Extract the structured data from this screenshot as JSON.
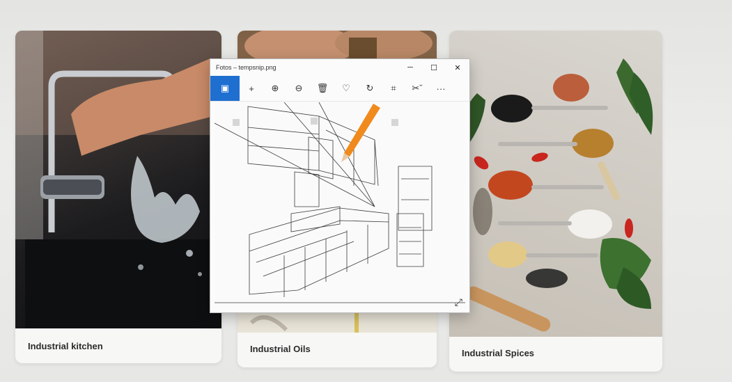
{
  "cards": [
    {
      "caption": "Industrial kitchen"
    },
    {
      "caption": "Industrial Oils"
    },
    {
      "caption": "Industrial Spices"
    }
  ],
  "viewer": {
    "title": "Fotos – tempsnip.png",
    "window_buttons": {
      "minimize": "─",
      "maximize": "☐",
      "close": "✕"
    },
    "toolbar": [
      {
        "name": "enhance-icon",
        "glyph": "▣",
        "active": true
      },
      {
        "name": "add-icon",
        "glyph": "+"
      },
      {
        "name": "zoom-in-icon",
        "glyph": "⊕"
      },
      {
        "name": "zoom-out-icon",
        "glyph": "⊖"
      },
      {
        "name": "delete-icon",
        "glyph": "🗑"
      },
      {
        "name": "favorite-icon",
        "glyph": "♡"
      },
      {
        "name": "rotate-icon",
        "glyph": "↻"
      },
      {
        "name": "crop-icon",
        "glyph": "⌗"
      },
      {
        "name": "edit-icon",
        "glyph": "✂ˇ"
      },
      {
        "name": "more-icon",
        "glyph": "···"
      }
    ],
    "expand_glyph": "⤢"
  },
  "colors": {
    "accent": "#1f6fd1",
    "pencil": "#f08a1c"
  }
}
